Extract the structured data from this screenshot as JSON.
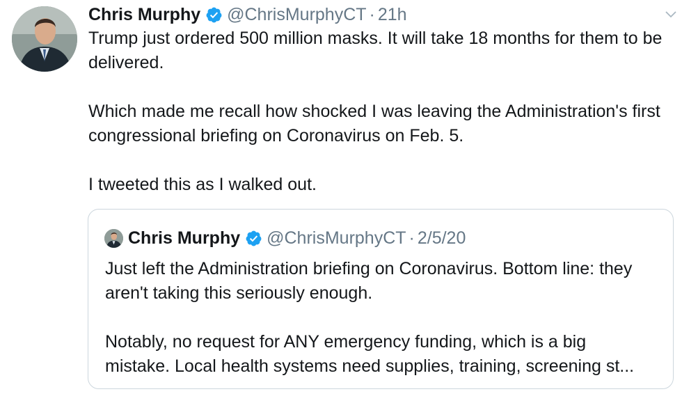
{
  "tweet": {
    "author_name": "Chris Murphy",
    "handle": "@ChrisMurphyCT",
    "separator": "·",
    "time": "21h",
    "paragraphs": [
      "Trump just ordered 500 million masks. It will take 18 months for them to be delivered.",
      "Which made me recall how shocked I was leaving the Administration's first congressional briefing on Coronavirus on Feb. 5.",
      "I tweeted this as I walked out."
    ]
  },
  "quoted_tweet": {
    "author_name": "Chris Murphy",
    "handle": "@ChrisMurphyCT",
    "separator": "·",
    "date": "2/5/20",
    "paragraphs": [
      "Just left the Administration briefing on Coronavirus. Bottom line: they aren't taking this seriously enough.",
      "Notably, no request for ANY emergency funding, which is a big",
      "mistake. Local health systems need supplies, training, screening st..."
    ]
  },
  "icons": {
    "verified": "verified-badge-icon",
    "caret": "chevron-down-icon"
  },
  "colors": {
    "text": "#14171a",
    "muted": "#657786",
    "verified_blue": "#1da1f2",
    "border": "#ccd6dd"
  }
}
